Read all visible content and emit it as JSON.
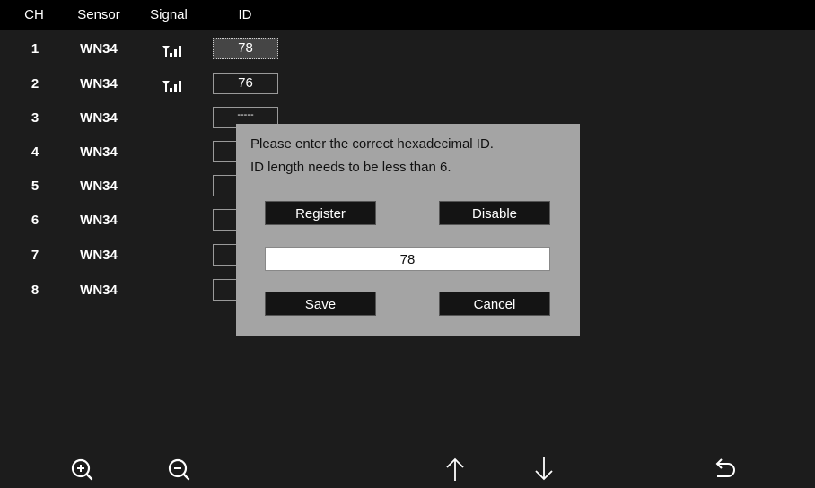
{
  "header": {
    "ch": "CH",
    "sensor": "Sensor",
    "signal": "Signal",
    "id": "ID"
  },
  "rows": [
    {
      "ch": "1",
      "sensor": "WN34",
      "signal": true,
      "id": "78",
      "selected": true
    },
    {
      "ch": "2",
      "sensor": "WN34",
      "signal": true,
      "id": "76"
    },
    {
      "ch": "3",
      "sensor": "WN34",
      "signal": false,
      "id": "-----"
    },
    {
      "ch": "4",
      "sensor": "WN34",
      "signal": false,
      "id": "-"
    },
    {
      "ch": "5",
      "sensor": "WN34",
      "signal": false,
      "id": "-"
    },
    {
      "ch": "6",
      "sensor": "WN34",
      "signal": false,
      "id": "-"
    },
    {
      "ch": "7",
      "sensor": "WN34",
      "signal": false,
      "id": "-"
    },
    {
      "ch": "8",
      "sensor": "WN34",
      "signal": false,
      "id": "-"
    }
  ],
  "dialog": {
    "line1": "Please enter the correct hexadecimal ID.",
    "line2": "ID length needs to be less than 6.",
    "register_label": "Register",
    "disable_label": "Disable",
    "input_value": "78",
    "save_label": "Save",
    "cancel_label": "Cancel"
  },
  "toolbar": {
    "icons": [
      "zoom-in-icon",
      "zoom-out-icon",
      "arrow-up-icon",
      "arrow-down-icon",
      "return-icon"
    ]
  },
  "colors": {
    "background": "#1c1c1c",
    "header": "#000000",
    "dialog": "#a4a4a4",
    "button": "#141414"
  }
}
